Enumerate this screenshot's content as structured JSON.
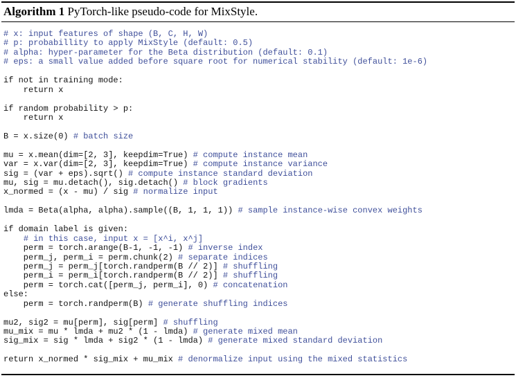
{
  "algorithm": {
    "label": "Algorithm 1",
    "caption": "PyTorch-like pseudo-code for MixStyle."
  },
  "code_lines": [
    {
      "code": "",
      "comment": "# x: input features of shape (B, C, H, W)"
    },
    {
      "code": "",
      "comment": "# p: probabillity to apply MixStyle (default: 0.5)"
    },
    {
      "code": "",
      "comment": "# alpha: hyper-parameter for the Beta distribution (default: 0.1)"
    },
    {
      "code": "",
      "comment": "# eps: a small value added before square root for numerical stability (default: 1e-6)"
    },
    {
      "code": "",
      "comment": ""
    },
    {
      "code": "if not in training mode:",
      "comment": ""
    },
    {
      "code": "    return x",
      "comment": ""
    },
    {
      "code": "",
      "comment": ""
    },
    {
      "code": "if random probability > p:",
      "comment": ""
    },
    {
      "code": "    return x",
      "comment": ""
    },
    {
      "code": "",
      "comment": ""
    },
    {
      "code": "B = x.size(0) ",
      "comment": "# batch size"
    },
    {
      "code": "",
      "comment": ""
    },
    {
      "code": "mu = x.mean(dim=[2, 3], keepdim=True) ",
      "comment": "# compute instance mean"
    },
    {
      "code": "var = x.var(dim=[2, 3], keepdim=True) ",
      "comment": "# compute instance variance"
    },
    {
      "code": "sig = (var + eps).sqrt() ",
      "comment": "# compute instance standard deviation"
    },
    {
      "code": "mu, sig = mu.detach(), sig.detach() ",
      "comment": "# block gradients"
    },
    {
      "code": "x_normed = (x - mu) / sig ",
      "comment": "# normalize input"
    },
    {
      "code": "",
      "comment": ""
    },
    {
      "code": "lmda = Beta(alpha, alpha).sample((B, 1, 1, 1)) ",
      "comment": "# sample instance-wise convex weights"
    },
    {
      "code": "",
      "comment": ""
    },
    {
      "code": "if domain label is given:",
      "comment": ""
    },
    {
      "code": "    ",
      "comment": "# in this case, input x = [x^i, x^j]"
    },
    {
      "code": "    perm = torch.arange(B-1, -1, -1) ",
      "comment": "# inverse index"
    },
    {
      "code": "    perm_j, perm_i = perm.chunk(2) ",
      "comment": "# separate indices"
    },
    {
      "code": "    perm_j = perm_j[torch.randperm(B // 2)] ",
      "comment": "# shuffling"
    },
    {
      "code": "    perm_i = perm_i[torch.randperm(B // 2)] ",
      "comment": "# shuffling"
    },
    {
      "code": "    perm = torch.cat([perm_j, perm_i], 0) ",
      "comment": "# concatenation"
    },
    {
      "code": "else:",
      "comment": ""
    },
    {
      "code": "    perm = torch.randperm(B) ",
      "comment": "# generate shuffling indices"
    },
    {
      "code": "",
      "comment": ""
    },
    {
      "code": "mu2, sig2 = mu[perm], sig[perm] ",
      "comment": "# shuffling"
    },
    {
      "code": "mu_mix = mu * lmda + mu2 * (1 - lmda) ",
      "comment": "# generate mixed mean"
    },
    {
      "code": "sig_mix = sig * lmda + sig2 * (1 - lmda) ",
      "comment": "# generate mixed standard deviation"
    },
    {
      "code": "",
      "comment": ""
    },
    {
      "code": "return x_normed * sig_mix + mu_mix ",
      "comment": "# denormalize input using the mixed statistics"
    }
  ]
}
